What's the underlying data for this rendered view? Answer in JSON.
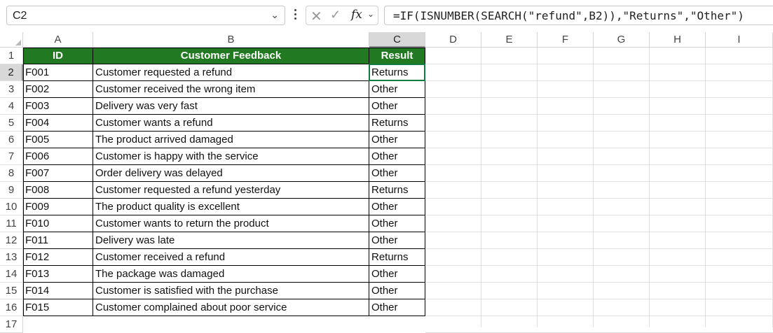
{
  "namebox": {
    "value": "C2"
  },
  "formula_bar": {
    "fx_label": "fx",
    "formula": "=IF(ISNUMBER(SEARCH(\"refund\",B2)),\"Returns\",\"Other\")"
  },
  "columns": [
    "A",
    "B",
    "C",
    "D",
    "E",
    "F",
    "G",
    "H",
    "I"
  ],
  "rows": [
    "1",
    "2",
    "3",
    "4",
    "5",
    "6",
    "7",
    "8",
    "9",
    "10",
    "11",
    "12",
    "13",
    "14",
    "15",
    "16",
    "17"
  ],
  "headers": {
    "id": "ID",
    "feedback": "Customer Feedback",
    "result": "Result"
  },
  "table": [
    {
      "id": "F001",
      "feedback": "Customer requested a refund",
      "result": "Returns"
    },
    {
      "id": "F002",
      "feedback": "Customer received the wrong item",
      "result": "Other"
    },
    {
      "id": "F003",
      "feedback": "Delivery was very fast",
      "result": "Other"
    },
    {
      "id": "F004",
      "feedback": "Customer wants a refund",
      "result": "Returns"
    },
    {
      "id": "F005",
      "feedback": "The product arrived damaged",
      "result": "Other"
    },
    {
      "id": "F006",
      "feedback": "Customer is happy with the service",
      "result": "Other"
    },
    {
      "id": "F007",
      "feedback": "Order delivery was delayed",
      "result": "Other"
    },
    {
      "id": "F008",
      "feedback": "Customer requested a refund yesterday",
      "result": "Returns"
    },
    {
      "id": "F009",
      "feedback": "The product quality is excellent",
      "result": "Other"
    },
    {
      "id": "F010",
      "feedback": "Customer wants to return the product",
      "result": "Other"
    },
    {
      "id": "F011",
      "feedback": "Delivery was late",
      "result": "Other"
    },
    {
      "id": "F012",
      "feedback": "Customer received a refund",
      "result": "Returns"
    },
    {
      "id": "F013",
      "feedback": "The package was damaged",
      "result": "Other"
    },
    {
      "id": "F014",
      "feedback": "Customer is satisfied with the purchase",
      "result": "Other"
    },
    {
      "id": "F015",
      "feedback": "Customer complained about poor service",
      "result": "Other"
    }
  ],
  "colors": {
    "header_fill": "#217a21",
    "header_text": "#ffffff",
    "selected_header": "#d8d8d8"
  }
}
